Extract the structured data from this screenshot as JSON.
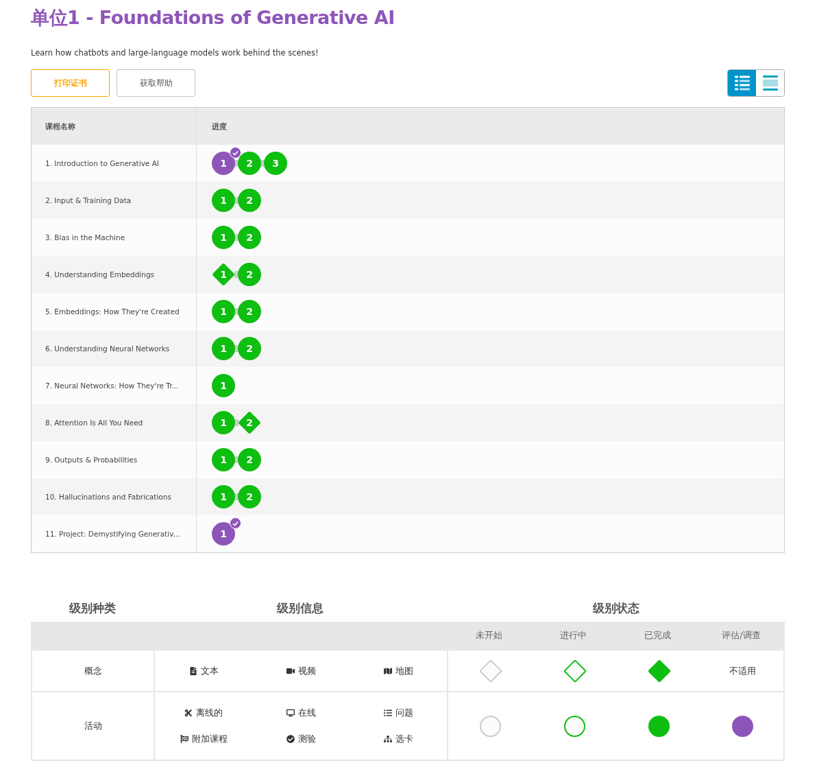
{
  "title": "单位1 - Foundations of Generative AI",
  "subtitle": "Learn how chatbots and large-language models work behind the scenes!",
  "buttons": [
    {
      "label": "打印证书",
      "kind": "primary"
    },
    {
      "label": "获取帮助",
      "kind": "secondary"
    }
  ],
  "view_toggle": [
    {
      "kind": "detail",
      "selected": true
    },
    {
      "kind": "summary",
      "selected": false
    }
  ],
  "table": {
    "columns": [
      "课程名称",
      "进度"
    ],
    "rows": [
      {
        "name": "1. Introduction to Generative AI",
        "levels": [
          {
            "label": "1",
            "kind": "circle",
            "color": "#8e55b8",
            "checked": true
          },
          {
            "label": "2",
            "kind": "circle",
            "color": "#0ebe11",
            "checked": false
          },
          {
            "label": "3",
            "kind": "circle",
            "color": "#0ebe11",
            "checked": false
          }
        ]
      },
      {
        "name": "2. Input & Training Data",
        "levels": [
          {
            "label": "1",
            "kind": "circle",
            "color": "#0ebe11",
            "checked": false
          },
          {
            "label": "2",
            "kind": "circle",
            "color": "#0ebe11",
            "checked": false
          }
        ]
      },
      {
        "name": "3. Bias in the Machine",
        "levels": [
          {
            "label": "1",
            "kind": "circle",
            "color": "#0ebe11",
            "checked": false
          },
          {
            "label": "2",
            "kind": "circle",
            "color": "#0ebe11",
            "checked": false
          }
        ]
      },
      {
        "name": "4. Understanding Embeddings",
        "levels": [
          {
            "label": "1",
            "kind": "diamond",
            "color": "#0ebe11",
            "checked": false
          },
          {
            "label": "2",
            "kind": "circle",
            "color": "#0ebe11",
            "checked": false
          }
        ]
      },
      {
        "name": "5. Embeddings: How They're Created",
        "levels": [
          {
            "label": "1",
            "kind": "circle",
            "color": "#0ebe11",
            "checked": false
          },
          {
            "label": "2",
            "kind": "circle",
            "color": "#0ebe11",
            "checked": false
          }
        ]
      },
      {
        "name": "6. Understanding Neural Networks",
        "levels": [
          {
            "label": "1",
            "kind": "circle",
            "color": "#0ebe11",
            "checked": false
          },
          {
            "label": "2",
            "kind": "circle",
            "color": "#0ebe11",
            "checked": false
          }
        ]
      },
      {
        "name": "7. Neural Networks: How They're Tr...",
        "levels": [
          {
            "label": "1",
            "kind": "circle",
            "color": "#0ebe11",
            "checked": false
          }
        ]
      },
      {
        "name": "8. Attention Is All You Need",
        "levels": [
          {
            "label": "1",
            "kind": "circle",
            "color": "#0ebe11",
            "checked": false
          },
          {
            "label": "2",
            "kind": "diamond",
            "color": "#0ebe11",
            "checked": false
          }
        ]
      },
      {
        "name": "9. Outputs & Probabilities",
        "levels": [
          {
            "label": "1",
            "kind": "circle",
            "color": "#0ebe11",
            "checked": false
          },
          {
            "label": "2",
            "kind": "circle",
            "color": "#0ebe11",
            "checked": false
          }
        ]
      },
      {
        "name": "10. Hallucinations and Fabrications",
        "levels": [
          {
            "label": "1",
            "kind": "circle",
            "color": "#0ebe11",
            "checked": false
          },
          {
            "label": "2",
            "kind": "circle",
            "color": "#0ebe11",
            "checked": false
          }
        ]
      },
      {
        "name": "11. Project: Demystifying Generativ...",
        "levels": [
          {
            "label": "1",
            "kind": "circle",
            "color": "#8e55b8",
            "checked": true
          }
        ]
      }
    ]
  },
  "legend": {
    "headings": [
      "级别种类",
      "级别信息",
      "级别状态"
    ],
    "status_columns": [
      "未开始",
      "进行中",
      "已完成",
      "评估/调查"
    ],
    "rows": [
      {
        "name": "概念",
        "kind": "diamond",
        "types": [
          "文本",
          "视频",
          "地图"
        ],
        "cells": [
          {
            "color": "#cccccc",
            "filled": false
          },
          {
            "color": "#0ebe11",
            "filled": false
          },
          {
            "color": "#0ebe11",
            "filled": true
          },
          {
            "text": "不适用"
          }
        ]
      },
      {
        "name": "活动",
        "kind": "circle",
        "types": [
          "离线的",
          "在线",
          "问题",
          "附加课程",
          "测验",
          "选卡"
        ],
        "cells": [
          {
            "color": "#cccccc",
            "filled": false
          },
          {
            "color": "#0ebe11",
            "filled": false
          },
          {
            "color": "#0ebe11",
            "filled": true
          },
          {
            "color": "#8e55b8",
            "filled": true
          }
        ]
      }
    ]
  }
}
